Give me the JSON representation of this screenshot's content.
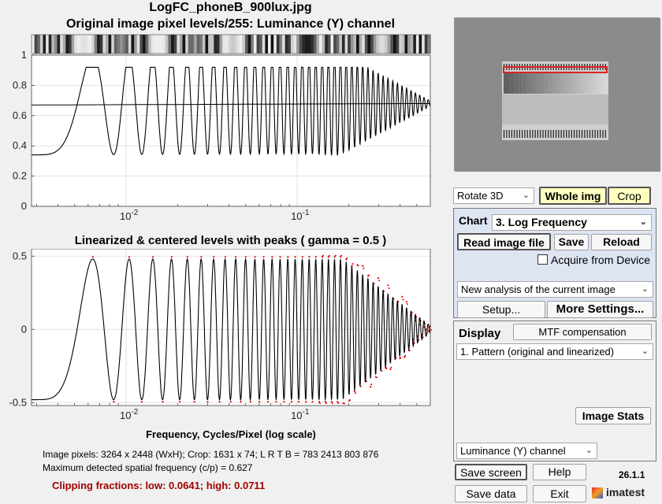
{
  "window": {
    "title": "LogFC_phoneB_900lux.jpg"
  },
  "plot_top": {
    "title": "Original image pixel levels/255:  Luminance (Y) channel"
  },
  "plot_bottom": {
    "title": "Linearized & centered levels with peaks ( gamma = 0.5 )",
    "xlabel": "Frequency, Cycles/Pixel (log scale)"
  },
  "info": {
    "line1": "Image pixels: 3264  x 2448 (WxH);   Crop: 1631  x 74;   L R T B = 783 2413 803 876",
    "line2": "Maximum detected spatial frequency (c/p) = 0.627",
    "clipping": "Clipping fractions:  low: 0.0641;  high: 0.0711"
  },
  "controls": {
    "rotate_select": "Rotate 3D",
    "whole_img": "Whole img",
    "crop": "Crop",
    "chart_label": "Chart",
    "chart_select": "3. Log Frequency",
    "read_image": "Read image file",
    "save": "Save",
    "reload": "Reload",
    "acquire": "Acquire from Device",
    "analysis_select": "New analysis of the current image",
    "setup": "Setup...",
    "more_settings": "More Settings...",
    "display_label": "Display",
    "mtf_comp": "MTF compensation",
    "display_select": "1. Pattern (original and linearized)",
    "image_stats": "Image Stats",
    "channel_select": "Luminance (Y) channel",
    "save_screen": "Save screen",
    "help": "Help",
    "version": "26.1.1",
    "save_data": "Save data",
    "exit": "Exit",
    "brand": "imatest"
  },
  "colors": {
    "highlight_yellow": "#ffffc0",
    "peaks": "#e00000",
    "clip_text": "#a00000",
    "panel_bg": "#dde4f2"
  },
  "chart_data": [
    {
      "type": "line",
      "title": "Original image pixel levels/255:  Luminance (Y) channel",
      "xscale": "log",
      "xlim": [
        0.0028,
        0.6
      ],
      "ylim": [
        0,
        1
      ],
      "xticks": [
        "10^-2",
        "10^-1"
      ],
      "yticks": [
        "0",
        "0.2",
        "0.4",
        "0.6",
        "0.8",
        "1"
      ],
      "series": [
        {
          "signal": "chirp",
          "mean_at": [
            0.0028,
            0.6
          ],
          "mean_values": [
            0.67,
            0.68
          ],
          "amplitude_start": 0.33,
          "min_observed": 0.18,
          "max_observed": 0.92,
          "x_range": [
            0.0028,
            0.6
          ]
        }
      ],
      "grid": true
    },
    {
      "type": "line",
      "title": "Linearized & centered levels with peaks ( gamma = 0.5 )",
      "xlabel": "Frequency, Cycles/Pixel (log scale)",
      "xscale": "log",
      "xlim": [
        0.0028,
        0.6
      ],
      "ylim": [
        -0.52,
        0.55
      ],
      "xticks": [
        "10^-2",
        "10^-1"
      ],
      "yticks": [
        "-0.5",
        "0",
        "0.5"
      ],
      "series": [
        {
          "signal": "chirp",
          "amplitude": 0.48,
          "x_range": [
            0.0028,
            0.6
          ]
        },
        {
          "signal": "peaks",
          "color": "#e00000"
        }
      ],
      "grid": true
    }
  ]
}
